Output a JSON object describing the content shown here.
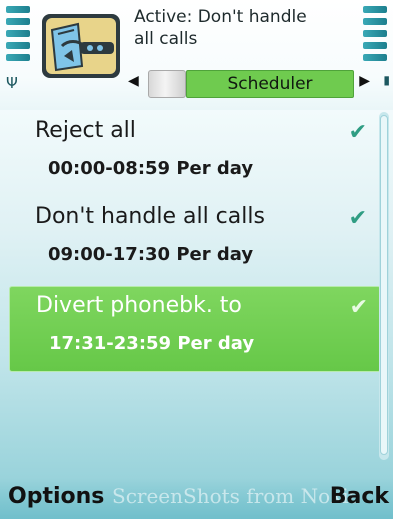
{
  "header": {
    "context_title": "Active: Don't handle all calls",
    "active_tab": "Scheduler"
  },
  "list": [
    {
      "primary": "Reject all",
      "secondary": "00:00-08:59 Per day",
      "selected": false
    },
    {
      "primary": "Don't handle all calls",
      "secondary": "09:00-17:30 Per day",
      "selected": false
    },
    {
      "primary": "Divert phonebk. to",
      "secondary": "17:31-23:59 Per day",
      "selected": true
    }
  ],
  "softkeys": {
    "left": "Options",
    "right": "Back"
  },
  "watermark": "ScreenShots from Nokia",
  "icons": {
    "signal": "signal-strength-icon",
    "battery": "battery-level-icon",
    "app": "call-manager-app-icon",
    "check": "check-icon"
  },
  "colors": {
    "selection": "#6fcb4f",
    "check": "#2f9d83",
    "accent": "#1d7f8e"
  }
}
